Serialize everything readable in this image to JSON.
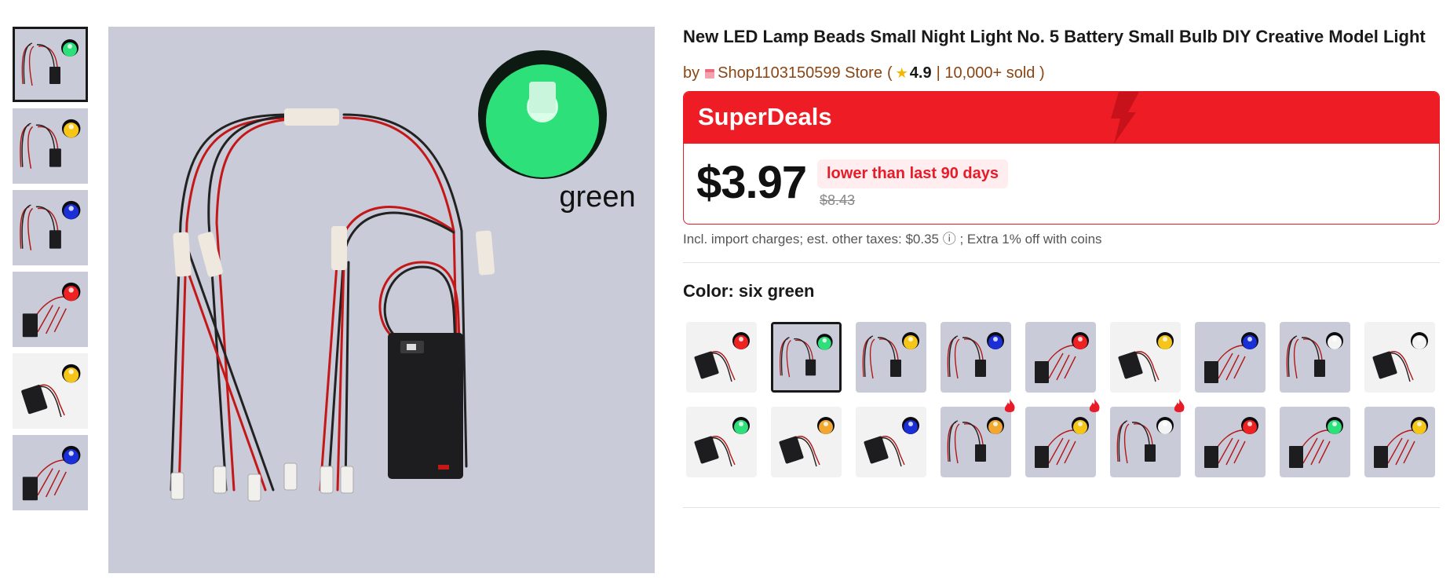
{
  "gallery": {
    "thumbnails": [
      {
        "color_name": "green",
        "led_color": "#2ee07a",
        "style": "multi",
        "selected": true
      },
      {
        "color_name": "yellow",
        "led_color": "#f5c518",
        "style": "multi",
        "selected": false
      },
      {
        "color_name": "blue",
        "led_color": "#1a2fd6",
        "style": "multi",
        "selected": false
      },
      {
        "color_name": "red",
        "led_color": "#ee2222",
        "style": "box",
        "selected": false
      },
      {
        "color_name": "yellow",
        "led_color": "#f5c518",
        "style": "single",
        "selected": false
      },
      {
        "color_name": "blue",
        "led_color": "#1a2fd6",
        "style": "box",
        "selected": false
      }
    ],
    "main_label": "green",
    "main_led_color": "#2ee07a"
  },
  "product": {
    "title": "New LED Lamp Beads Small Night Light No. 5 Battery Small Bulb DIY Creative Model Light",
    "by": "by",
    "store_name": "Shop1103150599 Store",
    "paren_open": "(",
    "rating": "4.9",
    "sold": "| 10,000+ sold )"
  },
  "superdeals": {
    "label": "SuperDeals",
    "price": "$3.97",
    "badge": "lower than last 90 days",
    "original_price": "$8.43"
  },
  "taxes_note": "Incl. import charges; est. other taxes: $0.35 ⓘ ; Extra 1% off with coins",
  "color": {
    "label": "Color:",
    "selected_name": "six green",
    "options": [
      {
        "color_name": "red",
        "led_color": "#ee2222",
        "style": "single",
        "selected": false,
        "hot": false
      },
      {
        "color_name": "green",
        "led_color": "#2ee07a",
        "style": "multi",
        "selected": true,
        "hot": false
      },
      {
        "color_name": "yellow",
        "led_color": "#f5c518",
        "style": "multi",
        "selected": false,
        "hot": false
      },
      {
        "color_name": "blue",
        "led_color": "#1a2fd6",
        "style": "multi",
        "selected": false,
        "hot": false
      },
      {
        "color_name": "red",
        "led_color": "#ee2222",
        "style": "box",
        "selected": false,
        "hot": false
      },
      {
        "color_name": "yellow",
        "led_color": "#f5c518",
        "style": "single",
        "selected": false,
        "hot": false
      },
      {
        "color_name": "blue",
        "led_color": "#1a2fd6",
        "style": "box",
        "selected": false,
        "hot": false
      },
      {
        "color_name": "white",
        "led_color": "#f4f4f4",
        "style": "multi",
        "selected": false,
        "hot": false
      },
      {
        "color_name": "white",
        "led_color": "#f4f4f4",
        "style": "single",
        "selected": false,
        "hot": false
      },
      {
        "color_name": "green",
        "led_color": "#2ee07a",
        "style": "single",
        "selected": false,
        "hot": false
      },
      {
        "color_name": "warm white",
        "led_color": "#f0a830",
        "style": "single",
        "selected": false,
        "hot": false
      },
      {
        "color_name": "blue",
        "led_color": "#1a2fd6",
        "style": "single",
        "selected": false,
        "hot": false
      },
      {
        "color_name": "warm white",
        "led_color": "#f0a830",
        "style": "multi",
        "selected": false,
        "hot": true
      },
      {
        "color_name": "warm white",
        "led_color": "#f5c518",
        "style": "box",
        "selected": false,
        "hot": true
      },
      {
        "color_name": "white",
        "led_color": "#f4f4f4",
        "style": "multi",
        "selected": false,
        "hot": true
      },
      {
        "color_name": "red",
        "led_color": "#ee2222",
        "style": "box",
        "selected": false,
        "hot": false
      },
      {
        "color_name": "green",
        "led_color": "#2ee07a",
        "style": "box",
        "selected": false,
        "hot": false
      },
      {
        "color_name": "yellow",
        "led_color": "#f5c518",
        "style": "box",
        "selected": false,
        "hot": false
      }
    ]
  },
  "colors": {
    "accent_red": "#ee1c25",
    "store_brown": "#8b4513",
    "star_gold": "#f7b500"
  }
}
